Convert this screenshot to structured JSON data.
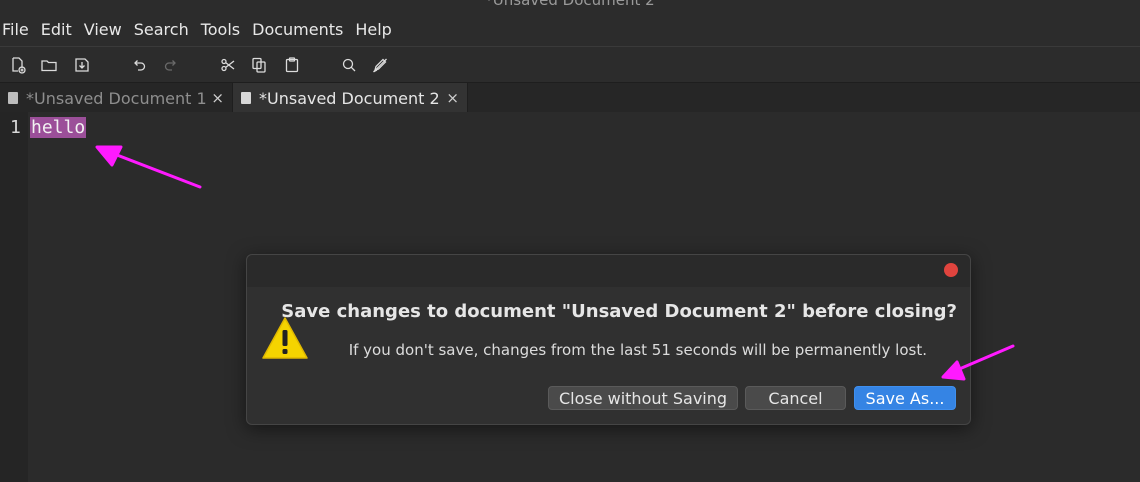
{
  "window": {
    "title": "*Unsaved Document 2"
  },
  "menu": [
    "File",
    "Edit",
    "View",
    "Search",
    "Tools",
    "Documents",
    "Help"
  ],
  "toolbar": {
    "icons": [
      "new-document-icon",
      "open-folder-icon",
      "save-icon",
      "undo-icon",
      "redo-icon",
      "cut-icon",
      "copy-icon",
      "paste-icon",
      "search-icon",
      "edit-pen-icon"
    ]
  },
  "tabs": [
    {
      "label": "*Unsaved Document 1",
      "close": "×",
      "active": false
    },
    {
      "label": "*Unsaved Document 2",
      "close": "×",
      "active": true
    }
  ],
  "editor": {
    "line_number": "1",
    "text": "hello"
  },
  "dialog": {
    "title": "Save changes to document \"Unsaved Document 2\" before closing?",
    "message": "If you don't save, changes from the last 51 seconds will be permanently lost.",
    "buttons": {
      "close_without_saving": "Close without Saving",
      "cancel": "Cancel",
      "save_as": "Save As..."
    }
  },
  "colors": {
    "selection": "#9b4f99",
    "primary_button": "#3584e4",
    "annotation_arrow": "#ff1aff",
    "close_dot": "#e0443e"
  }
}
